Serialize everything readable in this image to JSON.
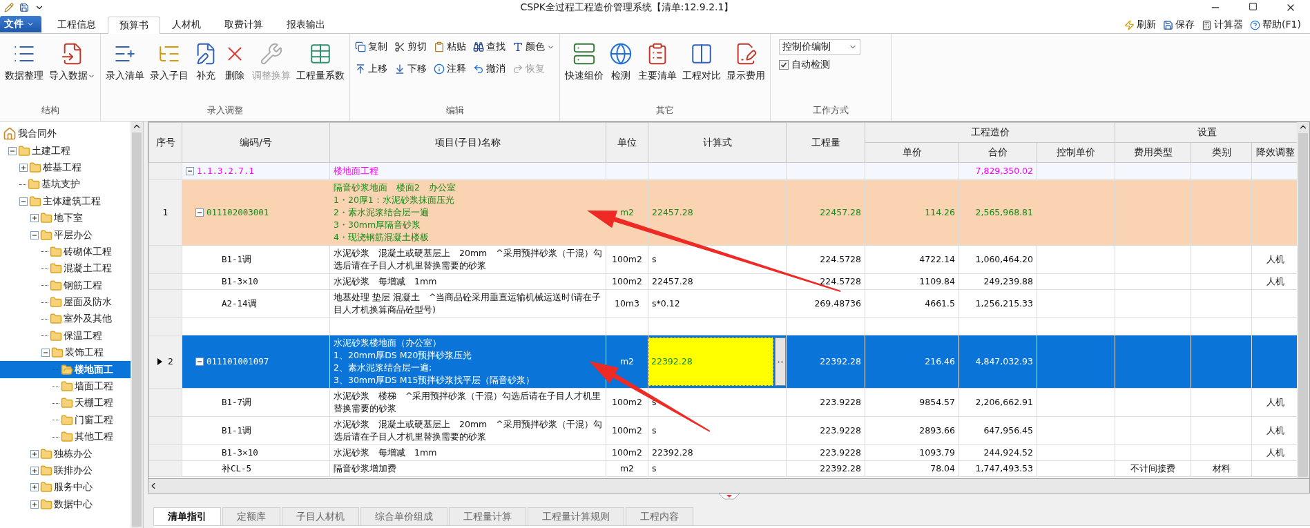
{
  "title": "CSPK全过程工程造价管理系统【清单:12.9.2.1】",
  "file_menu": "文件",
  "menu_tabs": [
    {
      "label": "工程信息",
      "selected": false
    },
    {
      "label": "预算书",
      "selected": true
    },
    {
      "label": "人材机",
      "selected": false
    },
    {
      "label": "取费计算",
      "selected": false
    },
    {
      "label": "报表输出",
      "selected": false
    }
  ],
  "quick_actions": [
    "刷新",
    "保存",
    "计算器",
    "帮助(F1)"
  ],
  "ribbon": [
    {
      "label": "结构",
      "kind": "large",
      "buttons": [
        {
          "label": "数据整理",
          "disabled": false,
          "dropdown": false
        },
        {
          "label": "导入数据",
          "disabled": false,
          "dropdown": true
        }
      ]
    },
    {
      "label": "录入调整",
      "kind": "large",
      "buttons": [
        {
          "label": "录入清单",
          "disabled": false,
          "dropdown": false
        },
        {
          "label": "录入子目",
          "disabled": false,
          "dropdown": false
        },
        {
          "label": "补充",
          "disabled": false,
          "dropdown": false
        },
        {
          "label": "删除",
          "disabled": false,
          "dropdown": false
        },
        {
          "label": "调整换算",
          "disabled": true,
          "dropdown": false
        },
        {
          "label": "工程量系数",
          "disabled": false,
          "dropdown": false
        }
      ]
    },
    {
      "label": "编辑",
      "kind": "small",
      "buttons": [
        {
          "label": "复制",
          "disabled": false,
          "dropdown": false
        },
        {
          "label": "剪切",
          "disabled": false,
          "dropdown": false
        },
        {
          "label": "粘贴",
          "disabled": false,
          "dropdown": false
        },
        {
          "label": "查找",
          "disabled": false,
          "dropdown": false
        },
        {
          "label": "颜色",
          "disabled": false,
          "dropdown": true
        },
        {
          "label": "上移",
          "disabled": false,
          "dropdown": false
        },
        {
          "label": "下移",
          "disabled": false,
          "dropdown": false
        },
        {
          "label": "注释",
          "disabled": false,
          "dropdown": false
        },
        {
          "label": "撤消",
          "disabled": false,
          "dropdown": false
        },
        {
          "label": "恢复",
          "disabled": true,
          "dropdown": false
        }
      ]
    },
    {
      "label": "其它",
      "kind": "large",
      "buttons": [
        {
          "label": "快速组价",
          "disabled": false,
          "dropdown": false
        },
        {
          "label": "检测",
          "disabled": false,
          "dropdown": false
        },
        {
          "label": "主要清单",
          "disabled": false,
          "dropdown": false
        },
        {
          "label": "工程对比",
          "disabled": false,
          "dropdown": false
        },
        {
          "label": "显示费用",
          "disabled": false,
          "dropdown": false
        }
      ]
    },
    {
      "label": "工作方式",
      "kind": "mode",
      "select": "控制价编制",
      "checkbox": {
        "label": "自动检测",
        "checked": true
      }
    }
  ],
  "tree": {
    "label": "我合同外",
    "selected": false,
    "children": [
      {
        "label": "土建工程",
        "expanded": true,
        "selected": false,
        "children": [
          {
            "label": "桩基工程",
            "expanded": false,
            "selected": false
          },
          {
            "label": "基坑支护",
            "selected": false
          },
          {
            "label": "主体建筑工程",
            "expanded": true,
            "selected": false,
            "children": [
              {
                "label": "地下室",
                "expanded": false,
                "selected": false
              },
              {
                "label": "平层办公",
                "expanded": true,
                "selected": false,
                "children": [
                  {
                    "label": "砖砌体工程",
                    "selected": false
                  },
                  {
                    "label": "混凝土工程",
                    "selected": false
                  },
                  {
                    "label": "钢筋工程",
                    "selected": false
                  },
                  {
                    "label": "屋面及防水",
                    "selected": false
                  },
                  {
                    "label": "室外及其他",
                    "selected": false
                  },
                  {
                    "label": "保温工程",
                    "selected": false
                  },
                  {
                    "label": "装饰工程",
                    "expanded": true,
                    "selected": false,
                    "children": [
                      {
                        "label": "楼地面工",
                        "selected": true
                      },
                      {
                        "label": "墙面工程",
                        "selected": false
                      },
                      {
                        "label": "天棚工程",
                        "selected": false
                      },
                      {
                        "label": "门窗工程",
                        "selected": false
                      },
                      {
                        "label": "其他工程",
                        "selected": false
                      }
                    ]
                  }
                ]
              },
              {
                "label": "独栋办公",
                "expanded": false,
                "selected": false
              },
              {
                "label": "联排办公",
                "expanded": false,
                "selected": false
              },
              {
                "label": "服务中心",
                "expanded": false,
                "selected": false
              },
              {
                "label": "数据中心",
                "expanded": false,
                "selected": false
              }
            ]
          }
        ]
      }
    ]
  },
  "table": {
    "columns": [
      {
        "label": "序号"
      },
      {
        "label": "编码/号"
      },
      {
        "label": "项目(子目)名称"
      },
      {
        "label": "单位"
      },
      {
        "label": "计算式"
      },
      {
        "label": "工程量"
      },
      {
        "label": "工程造价",
        "children": [
          "单价",
          "合价",
          "控制单价"
        ]
      },
      {
        "label": "设置",
        "children": [
          "费用类型",
          "类别",
          "降效调整"
        ]
      }
    ],
    "rows": [
      {
        "kind": "group",
        "selected": false,
        "expanded": true,
        "code": "1.1.3.2.7.1",
        "name": "楼地面工程",
        "total": "7,829,350.02"
      },
      {
        "kind": "item",
        "selected": false,
        "editing": false,
        "expanded": true,
        "index": "1",
        "code": "011102003001",
        "name": "隔音砂浆地面　楼面2　办公室\n1・20厚1：水泥砂浆抹面压光\n2・素水泥浆结合层一遍\n3・30mm厚隔音砂浆\n4・现浇钢筋混凝土楼板",
        "unit": "m2",
        "formula": "22457.28",
        "qty": "22457.28",
        "price": "114.26",
        "total": "2,565,968.81"
      },
      {
        "kind": "sub",
        "selected": false,
        "code": "B1-1调",
        "name": "水泥砂浆　混凝土或硬基层上　20mm　^采用预拌砂浆（干混）勾选后请在子目人才机里替换需要的砂浆",
        "unit": "100m2",
        "formula": "s",
        "qty": "224.5728",
        "price": "4722.14",
        "total": "1,060,464.20",
        "adjust": "人机"
      },
      {
        "kind": "sub",
        "selected": false,
        "code": "B1-3×10",
        "name": "水泥砂浆　每增减　1mm",
        "unit": "100m2",
        "formula": "22457.28",
        "qty": "224.5728",
        "price": "1109.84",
        "total": "249,239.88",
        "adjust": "人机"
      },
      {
        "kind": "sub",
        "selected": false,
        "code": "A2-14调",
        "name": "地基处理 垫层 混凝土　^当商品砼采用垂直运输机械运送时(请在子目人才机换算商品砼型号)",
        "unit": "10m3",
        "formula": "s*0.12",
        "qty": "269.48736",
        "price": "4661.5",
        "total": "1,256,215.33"
      },
      {
        "kind": "empty",
        "selected": false
      },
      {
        "kind": "item",
        "selected": true,
        "editing": true,
        "expanded": true,
        "index": "2",
        "code": "011101001097",
        "name": "水泥砂浆楼地面（办公室）\n1、20mm厚DS M20预拌砂浆压光\n2、素水泥浆结合层一遍;\n3、30mm厚DS M15预拌砂浆找平层（隔音砂浆）",
        "unit": "m2",
        "formula": "22392.28",
        "qty": "22392.28",
        "price": "216.46",
        "total": "4,847,032.93"
      },
      {
        "kind": "sub",
        "selected": false,
        "code": "B1-7调",
        "name": "水泥砂浆　楼梯　^采用预拌砂浆（干混）勾选后请在子目人才机里替换需要的砂浆",
        "unit": "100m2",
        "formula": "s",
        "qty": "223.9228",
        "price": "9854.57",
        "total": "2,206,662.91",
        "adjust": "人机"
      },
      {
        "kind": "sub",
        "selected": false,
        "code": "B1-1调",
        "name": "水泥砂浆　混凝土或硬基层上　20mm　^采用预拌砂浆（干混）勾选后请在子目人才机里替换需要的砂浆",
        "unit": "100m2",
        "formula": "s",
        "qty": "223.9228",
        "price": "2893.66",
        "total": "647,956.45",
        "adjust": "人机"
      },
      {
        "kind": "sub",
        "selected": false,
        "code": "B1-3×10",
        "name": "水泥砂浆　每增减　1mm",
        "unit": "100m2",
        "formula": "22392.28",
        "qty": "223.9228",
        "price": "1093.79",
        "total": "244,924.52",
        "adjust": "人机"
      },
      {
        "kind": "sub",
        "selected": false,
        "code": "补CL-5",
        "name": "隔音砂浆增加费",
        "unit": "m2",
        "formula": "s",
        "qty": "22392.28",
        "price": "78.04",
        "total": "1,747,493.53",
        "fee_type": "不计间接费",
        "category": "材料"
      }
    ]
  },
  "bottom_tabs": [
    {
      "label": "清单指引",
      "selected": true
    },
    {
      "label": "定额库",
      "selected": false
    },
    {
      "label": "子目人材机",
      "selected": false
    },
    {
      "label": "综合单价组成",
      "selected": false
    },
    {
      "label": "工程量计算",
      "selected": false
    },
    {
      "label": "工程量计算规则",
      "selected": false
    },
    {
      "label": "工程内容",
      "selected": false
    }
  ]
}
